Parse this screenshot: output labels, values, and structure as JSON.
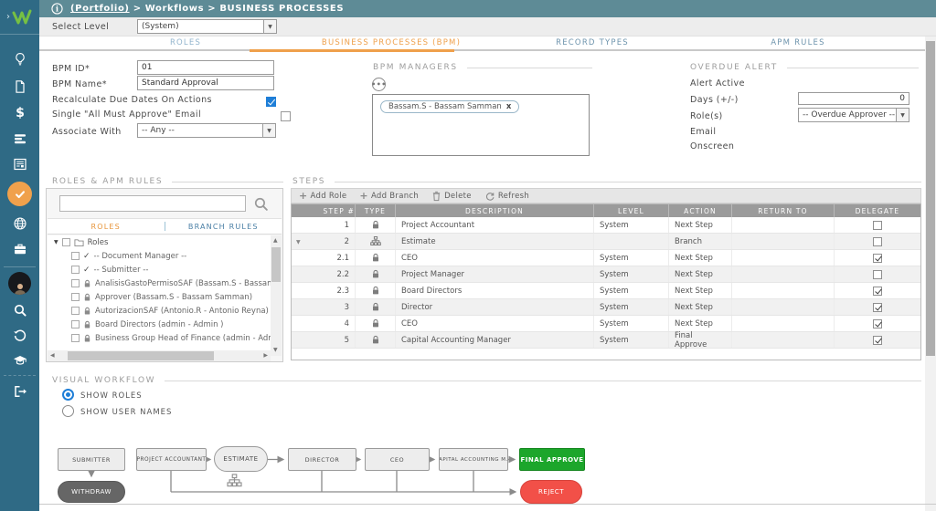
{
  "topbar": {
    "breadcrumb_portfolio": "(Portfolio)",
    "breadcrumb_sep1": ">",
    "breadcrumb_workflows": "Workflows",
    "breadcrumb_sep2": ">",
    "breadcrumb_current": "BUSINESS PROCESSES"
  },
  "select_level": {
    "label": "Select Level",
    "value": "(System)"
  },
  "tabs": {
    "roles": "ROLES",
    "bpm": "BUSINESS PROCESSES (BPM)",
    "record_types": "RECORD TYPES",
    "apm_rules": "APM RULES"
  },
  "form": {
    "bpm_id_label": "BPM ID*",
    "bpm_id_value": "01",
    "bpm_name_label": "BPM Name*",
    "bpm_name_value": "Standard Approval",
    "recalc_label": "Recalculate Due Dates On Actions",
    "recalc_checked": true,
    "single_email_label": "Single \"All Must Approve\" Email",
    "single_email_checked": false,
    "associate_label": "Associate With",
    "associate_value": "-- Any --"
  },
  "bpm_managers": {
    "title": "BPM MANAGERS",
    "tag_label": "Bassam.S - Bassam Samman",
    "tag_remove": "x",
    "ellipsis": "•••"
  },
  "overdue_alert": {
    "title": "OVERDUE ALERT",
    "alert_active_label": "Alert Active",
    "alert_active_checked": false,
    "days_label": "Days (+/-)",
    "days_value": "0",
    "roles_label": "Role(s)",
    "roles_value": "-- Overdue Approver --",
    "email_label": "Email",
    "email_checked": false,
    "onscreen_label": "Onscreen",
    "onscreen_checked": false
  },
  "roles_panel": {
    "title": "ROLES & APM RULES",
    "tab_roles": "ROLES",
    "tab_branch": "BRANCH RULES",
    "root_label": "Roles",
    "items": [
      {
        "icon": "check",
        "label": "-- Document Manager --"
      },
      {
        "icon": "check",
        "label": "-- Submitter --"
      },
      {
        "icon": "lock",
        "label": "AnalisisGastoPermisoSAF (Bassam.S - Bassam Sam"
      },
      {
        "icon": "lock",
        "label": "Approver (Bassam.S - Bassam Samman)"
      },
      {
        "icon": "lock",
        "label": "AutorizacionSAF (Antonio.R - Antonio Reyna)"
      },
      {
        "icon": "lock",
        "label": "Board Directors (admin - Admin )"
      },
      {
        "icon": "lock",
        "label": "Business Group Head of Finance (admin - Admin )"
      }
    ]
  },
  "steps": {
    "title": "STEPS",
    "toolbar": {
      "add_role": "Add Role",
      "add_branch": "Add Branch",
      "delete": "Delete",
      "refresh": "Refresh"
    },
    "columns": [
      "STEP #",
      "TYPE",
      "DESCRIPTION",
      "LEVEL",
      "ACTION",
      "RETURN TO",
      "DELEGATE"
    ],
    "rows": [
      {
        "step": "1",
        "type": "lock",
        "description": "Project Accountant",
        "level": "System",
        "action": "Next Step",
        "return_to": "",
        "delegate": false,
        "expand": false
      },
      {
        "step": "2",
        "type": "branch",
        "description": "Estimate",
        "level": "",
        "action": "Branch",
        "return_to": "",
        "delegate": false,
        "expand": true
      },
      {
        "step": "2.1",
        "type": "lock",
        "description": "CEO",
        "level": "System",
        "action": "Next Step",
        "return_to": "",
        "delegate": true,
        "expand": false
      },
      {
        "step": "2.2",
        "type": "lock",
        "description": "Project Manager",
        "level": "System",
        "action": "Next Step",
        "return_to": "",
        "delegate": false,
        "expand": false
      },
      {
        "step": "2.3",
        "type": "lock",
        "description": "Board Directors",
        "level": "System",
        "action": "Next Step",
        "return_to": "",
        "delegate": true,
        "expand": false
      },
      {
        "step": "3",
        "type": "lock",
        "description": "Director",
        "level": "System",
        "action": "Next Step",
        "return_to": "",
        "delegate": true,
        "expand": false
      },
      {
        "step": "4",
        "type": "lock",
        "description": "CEO",
        "level": "System",
        "action": "Next Step",
        "return_to": "",
        "delegate": true,
        "expand": false
      },
      {
        "step": "5",
        "type": "lock",
        "description": "Capital Accounting Manager",
        "level": "System",
        "action": "Final Approve",
        "return_to": "",
        "delegate": true,
        "expand": false
      }
    ]
  },
  "visual_workflow": {
    "title": "VISUAL WORKFLOW",
    "radio_show_roles": "SHOW ROLES",
    "radio_show_user_names": "SHOW USER NAMES",
    "selected_radio": "roles",
    "nodes": {
      "submitter": "SUBMITTER",
      "withdraw": "WITHDRAW",
      "project_accountant": "PROJECT ACCOUNTANT",
      "estimate": "ESTIMATE",
      "director": "DIRECTOR",
      "ceo": "CEO",
      "capital_accounting": "CAPITAL ACCOUNTING M...",
      "final_approve": "FINAL APPROVE",
      "reject": "REJECT"
    }
  },
  "sidebar_icons": [
    "lightbulb-icon",
    "document-icon",
    "dollar-icon",
    "list-icon",
    "form-icon",
    "check-circle-icon",
    "globe-icon",
    "briefcase-icon",
    "avatar",
    "search-icon",
    "history-icon",
    "graduation-cap-icon",
    "logout-icon"
  ],
  "colors": {
    "sidebar": "#2f6a85",
    "topbar": "#5e8b96",
    "accent_orange": "#efa04b",
    "accent_blue": "#1e7ed7",
    "tab_blue": "#6e94ad",
    "table_header": "#9b9b9b",
    "approve_green": "#1ca62b",
    "reject_red": "#f25048",
    "withdraw_gray": "#666666"
  }
}
